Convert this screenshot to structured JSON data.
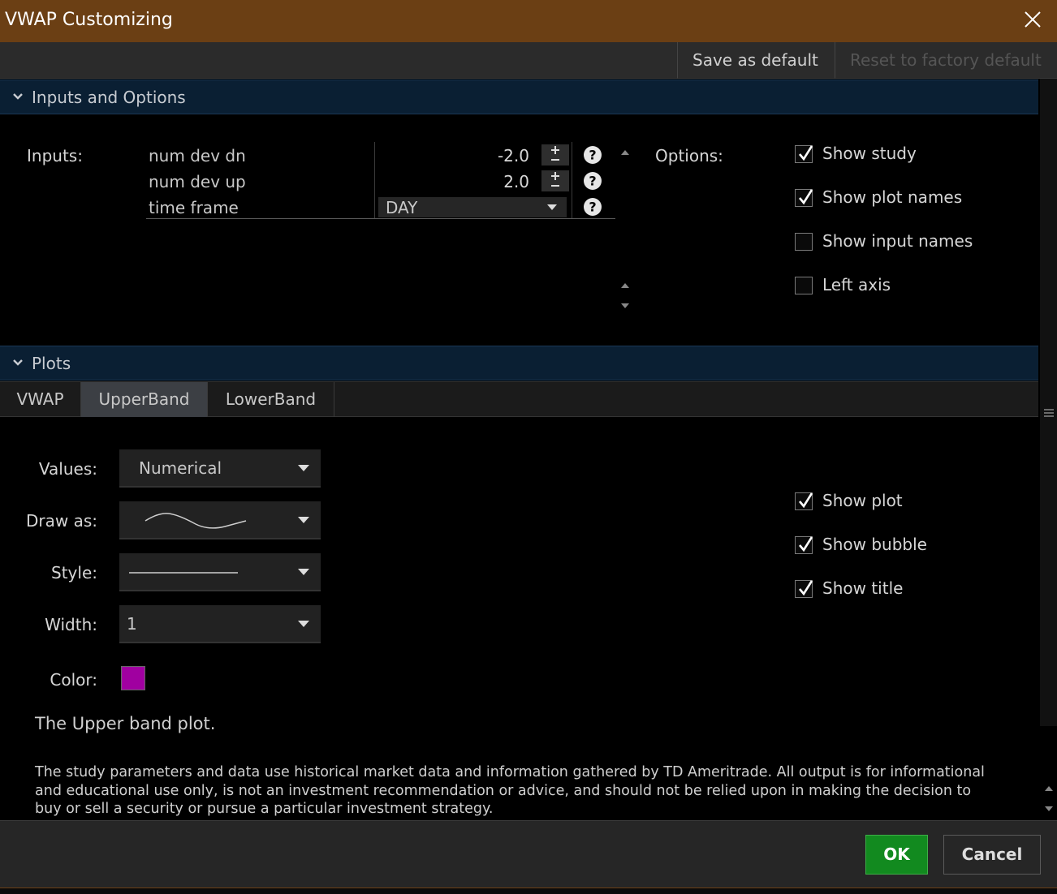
{
  "window": {
    "title": "VWAP Customizing"
  },
  "toolbar": {
    "save_default": "Save as default",
    "reset_factory": "Reset to factory default"
  },
  "inputs_section": {
    "header": "Inputs and Options",
    "inputs_label": "Inputs:",
    "rows": [
      {
        "name": "num dev dn",
        "value": "-2.0"
      },
      {
        "name": "num dev up",
        "value": "2.0"
      },
      {
        "name": "time frame",
        "value": "DAY"
      }
    ],
    "options_label": "Options:",
    "options": [
      {
        "label": "Show study",
        "checked": true
      },
      {
        "label": "Show plot names",
        "checked": true
      },
      {
        "label": "Show input names",
        "checked": false
      },
      {
        "label": "Left axis",
        "checked": false
      }
    ]
  },
  "plots_section": {
    "header": "Plots",
    "tabs": [
      "VWAP",
      "UpperBand",
      "LowerBand"
    ],
    "active_tab": "UpperBand",
    "values_label": "Values:",
    "values_value": "Numerical",
    "draw_as_label": "Draw as:",
    "style_label": "Style:",
    "width_label": "Width:",
    "width_value": "1",
    "color_label": "Color:",
    "color_value": "#a000a0",
    "checks": [
      {
        "label": "Show plot",
        "checked": true
      },
      {
        "label": "Show bubble",
        "checked": true
      },
      {
        "label": "Show title",
        "checked": true
      }
    ],
    "description": "The Upper band plot."
  },
  "disclaimer": "The study parameters and data use historical market data and information gathered by TD Ameritrade. All output is for informational and educational use only, is not an investment recommendation or advice, and should not be relied upon in making the decision to buy or sell a security or pursue a particular investment strategy.",
  "footer": {
    "ok": "OK",
    "cancel": "Cancel"
  },
  "colors": {
    "titlebar": "#6b3f14",
    "section_header": "#0a1f33",
    "ok_button": "#128a1f",
    "plot_color": "#a000a0"
  }
}
